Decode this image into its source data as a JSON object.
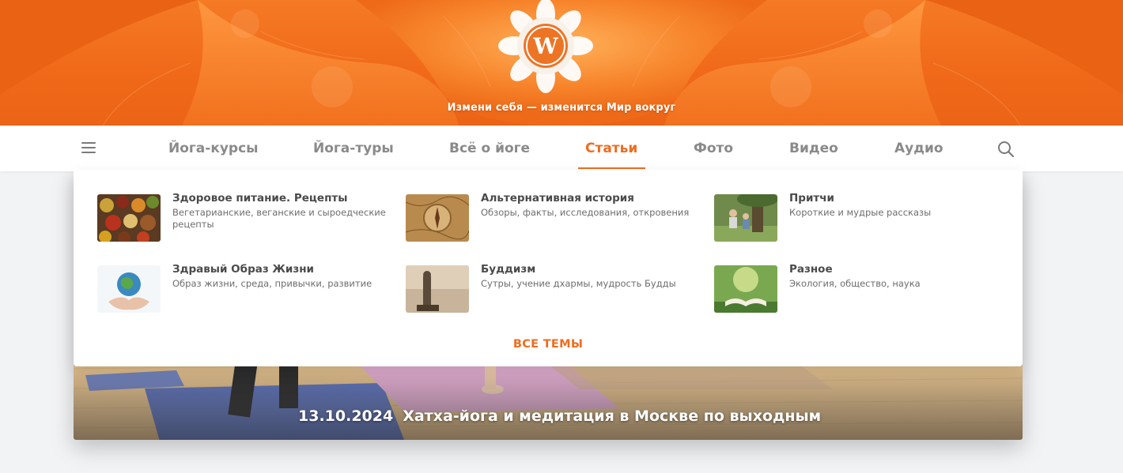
{
  "banner": {
    "slogan": "Измени себя — изменится Мир вокруг",
    "logo_letter": "W"
  },
  "nav": {
    "items": [
      {
        "label": "Йога-курсы"
      },
      {
        "label": "Йога-туры"
      },
      {
        "label": "Всё о йоге"
      },
      {
        "label": "Статьи",
        "active": true
      },
      {
        "label": "Фото"
      },
      {
        "label": "Видео"
      },
      {
        "label": "Аудио"
      }
    ],
    "menu_icon": "hamburger-menu-icon",
    "search_icon": "search-icon"
  },
  "dropdown": {
    "categories": [
      {
        "title": "Здоровое питание. Рецепты",
        "desc": "Вегетарианские, веганские и сыроедческие рецепты",
        "icon": "spices-thumbnail"
      },
      {
        "title": "Альтернативная история",
        "desc": "Обзоры, факты, исследования, откровения",
        "icon": "map-compass-thumbnail"
      },
      {
        "title": "Притчи",
        "desc": "Короткие и мудрые рассказы",
        "icon": "tree-people-thumbnail"
      },
      {
        "title": "Здравый Образ Жизни",
        "desc": "Образ жизни, среда, привычки, развитие",
        "icon": "globe-hands-thumbnail"
      },
      {
        "title": "Буддизм",
        "desc": "Сутры, учение дхармы, мудрость Будды",
        "icon": "buddha-statue-thumbnail"
      },
      {
        "title": "Разное",
        "desc": "Экология, общество, наука",
        "icon": "open-book-thumbnail"
      }
    ],
    "all_topics": "ВСЕ ТЕМЫ"
  },
  "hero": {
    "date": "13.10.2024",
    "title": "Хатха-йога и медитация в Москве по выходным"
  },
  "colors": {
    "accent": "#ef6c1f",
    "banner": "#f06a1a",
    "nav_text": "#8a8a8a"
  }
}
